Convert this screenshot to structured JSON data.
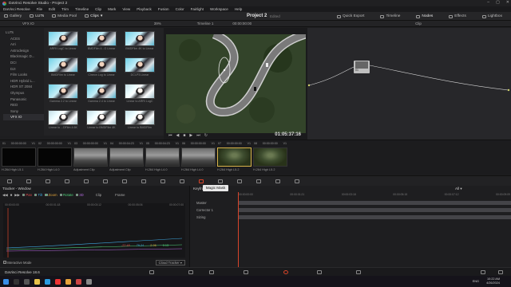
{
  "window": {
    "app_name": "DaVinci Resolve Studio - Project 2"
  },
  "menu": [
    "DaVinci Resolve",
    "File",
    "Edit",
    "Trim",
    "Timeline",
    "Clip",
    "Mark",
    "View",
    "Playback",
    "Fusion",
    "Color",
    "Fairlight",
    "Workspace",
    "Help"
  ],
  "toolbar": {
    "gallery": "Gallery",
    "luts": "LUTs",
    "media_pool": "Media Pool",
    "clips": "Clips",
    "project_title": "Project 2",
    "project_status": "Edited",
    "quick_export": "Quick Export",
    "timeline": "Timeline",
    "nodes": "Nodes",
    "effects": "Effects",
    "lightbox": "Lightbox"
  },
  "subbar": {
    "album": "VFX IO",
    "zoom": "39%",
    "timeline_name": "Timeline 1",
    "timecode": "00:00:00:00",
    "node_mode": "Clip"
  },
  "album_list": [
    {
      "label": "LUTs",
      "selected": false,
      "root": true
    },
    {
      "label": "ACES",
      "selected": false
    },
    {
      "label": "Arri",
      "selected": false
    },
    {
      "label": "Astrodesign",
      "selected": false
    },
    {
      "label": "Blackmagic D...",
      "selected": false
    },
    {
      "label": "DCI",
      "selected": false
    },
    {
      "label": "DJI",
      "selected": false
    },
    {
      "label": "Film Looks",
      "selected": false
    },
    {
      "label": "HDR Hybrid L...",
      "selected": false
    },
    {
      "label": "HDR ST 2084",
      "selected": false
    },
    {
      "label": "Olympus",
      "selected": false
    },
    {
      "label": "Panasonic",
      "selected": false
    },
    {
      "label": "RED",
      "selected": false
    },
    {
      "label": "Sony",
      "selected": false
    },
    {
      "label": "VFX IO",
      "selected": true
    }
  ],
  "stills": [
    {
      "caption": "ARRI LogC to Linear",
      "dim": false
    },
    {
      "caption": "BMDFilm 4...G Linear",
      "dim": false
    },
    {
      "caption": "BMDFilm 4K to Linear",
      "dim": false
    },
    {
      "caption": "BMDFilm to Linear",
      "dim": false
    },
    {
      "caption": "Cineon Log to Linear",
      "dim": false
    },
    {
      "caption": "DCI-P3 Linear",
      "dim": false
    },
    {
      "caption": "Gamma 2.2 to Linear",
      "dim": false
    },
    {
      "caption": "Gamma 2.4 to Linear",
      "dim": false
    },
    {
      "caption": "Linear to ARRI LogC",
      "dim": true
    },
    {
      "caption": "Linear to ...DFilm 4.6K",
      "dim": true
    },
    {
      "caption": "Linear to BMDFilm 4K",
      "dim": true
    },
    {
      "caption": "Linear to BMDFilm",
      "dim": true
    }
  ],
  "viewer": {
    "timecode": "01:05:37:16"
  },
  "clips": [
    {
      "num": "01",
      "tc": "00:00:00:00",
      "track": "V1",
      "name": "H.264 High L5.1",
      "style": "black"
    },
    {
      "num": "02",
      "tc": "00:00:00:00",
      "track": "V1",
      "name": "H.264 High L4.0",
      "style": "black"
    },
    {
      "num": "03",
      "tc": "00:00:00:00",
      "track": "V1",
      "name": "Adjustment Clip",
      "style": "car"
    },
    {
      "num": "04",
      "tc": "00:00:04:23",
      "track": "V1",
      "name": "Adjustment Clip",
      "style": "car"
    },
    {
      "num": "05",
      "tc": "00:00:04:23",
      "track": "V1",
      "name": "H.264 High L4.0",
      "style": "car"
    },
    {
      "num": "06",
      "tc": "00:00:00:00",
      "track": "V1",
      "name": "H.264 High L4.0",
      "style": "car"
    },
    {
      "num": "07",
      "tc": "00:00:00:00",
      "track": "V1",
      "name": "H.264 High L5.2",
      "style": "winding"
    },
    {
      "num": "08",
      "tc": "00:00:00:00",
      "track": "V1",
      "name": "H.264 High L5.2",
      "style": "winding"
    }
  ],
  "tooltip": "Magic Mask",
  "tracker": {
    "title": "Tracker - Window",
    "pan": "Pan",
    "tilt": "Tilt",
    "zoom": "Zoom",
    "rotate": "Rotate",
    "three_d": "3D",
    "mode": "Clip",
    "frame": "Frame",
    "ruler": [
      "00:00:00:00",
      "00:00:01:18",
      "00:00:03:12",
      "00:00:05:06",
      "00:00:07:00"
    ],
    "readouts": [
      "-22.48",
      "79.24",
      "2.96",
      "0.13"
    ],
    "interactive_mode": "Interactive Mode",
    "cloud_tracker": "Cloud Tracker",
    "colors": {
      "pan": "#e24b4b",
      "tilt": "#3fa8e0",
      "zoom": "#e0a43a",
      "rotate": "#4fd17a",
      "three_d": "#b56be0"
    }
  },
  "keyframes": {
    "title": "Keyframes",
    "filter": "All",
    "ruler": [
      "00:00:00:00",
      "00:00:01:21",
      "00:00:03:18",
      "00:00:05:15",
      "00:00:07:12",
      "00:00:09:09"
    ],
    "rows": [
      "Master",
      "Corrector 1",
      "Sizing"
    ]
  },
  "bottom": {
    "app_label": "DaVinci Resolve 18.6"
  },
  "taskbar": {
    "lang": "ENG",
    "time": "10:22 AM",
    "date": "4/26/2024"
  }
}
